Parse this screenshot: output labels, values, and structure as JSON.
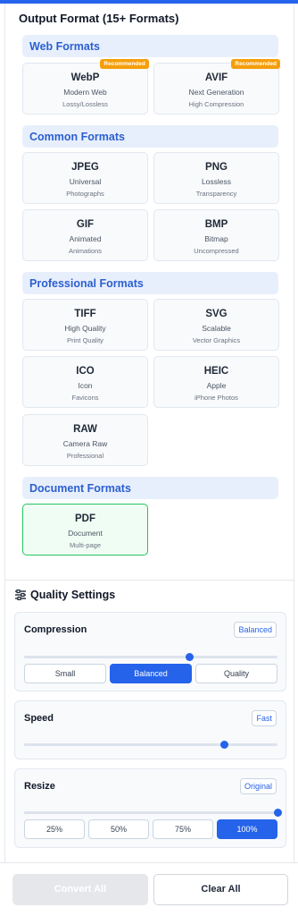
{
  "output_format": {
    "title": "Output Format (15+ Formats)",
    "groups": [
      {
        "header": "Web Formats",
        "formats": [
          {
            "name": "WebP",
            "desc": "Modern Web",
            "detail": "Lossy/Lossless",
            "badge": "Recommended"
          },
          {
            "name": "AVIF",
            "desc": "Next Generation",
            "detail": "High Compression",
            "badge": "Recommended"
          }
        ]
      },
      {
        "header": "Common Formats",
        "formats": [
          {
            "name": "JPEG",
            "desc": "Universal",
            "detail": "Photographs"
          },
          {
            "name": "PNG",
            "desc": "Lossless",
            "detail": "Transparency"
          },
          {
            "name": "GIF",
            "desc": "Animated",
            "detail": "Animations"
          },
          {
            "name": "BMP",
            "desc": "Bitmap",
            "detail": "Uncompressed"
          }
        ]
      },
      {
        "header": "Professional Formats",
        "formats": [
          {
            "name": "TIFF",
            "desc": "High Quality",
            "detail": "Print Quality"
          },
          {
            "name": "SVG",
            "desc": "Scalable",
            "detail": "Vector Graphics"
          },
          {
            "name": "ICO",
            "desc": "Icon",
            "detail": "Favicons"
          },
          {
            "name": "HEIC",
            "desc": "Apple",
            "detail": "iPhone Photos"
          },
          {
            "name": "RAW",
            "desc": "Camera Raw",
            "detail": "Professional"
          }
        ]
      },
      {
        "header": "Document Formats",
        "formats": [
          {
            "name": "PDF",
            "desc": "Document",
            "detail": "Multi-page",
            "selected": true
          }
        ]
      }
    ]
  },
  "quality_settings": {
    "title": "Quality Settings",
    "icon": "sliders-icon",
    "compression": {
      "label": "Compression",
      "value_label": "Balanced",
      "slider_fraction": 0.65,
      "options": [
        "Small",
        "Balanced",
        "Quality"
      ],
      "active": "Balanced"
    },
    "speed": {
      "label": "Speed",
      "value_label": "Fast",
      "slider_fraction": 0.79
    },
    "resize": {
      "label": "Resize",
      "value_label": "Original",
      "slider_fraction": 1.0,
      "options": [
        "25%",
        "50%",
        "75%",
        "100%"
      ],
      "active": "100%"
    }
  },
  "actions": {
    "convert_label": "Convert All",
    "clear_label": "Clear All"
  },
  "colors": {
    "accent": "#2563eb",
    "badge": "#f59e0b",
    "selected_border": "#22c55e"
  }
}
